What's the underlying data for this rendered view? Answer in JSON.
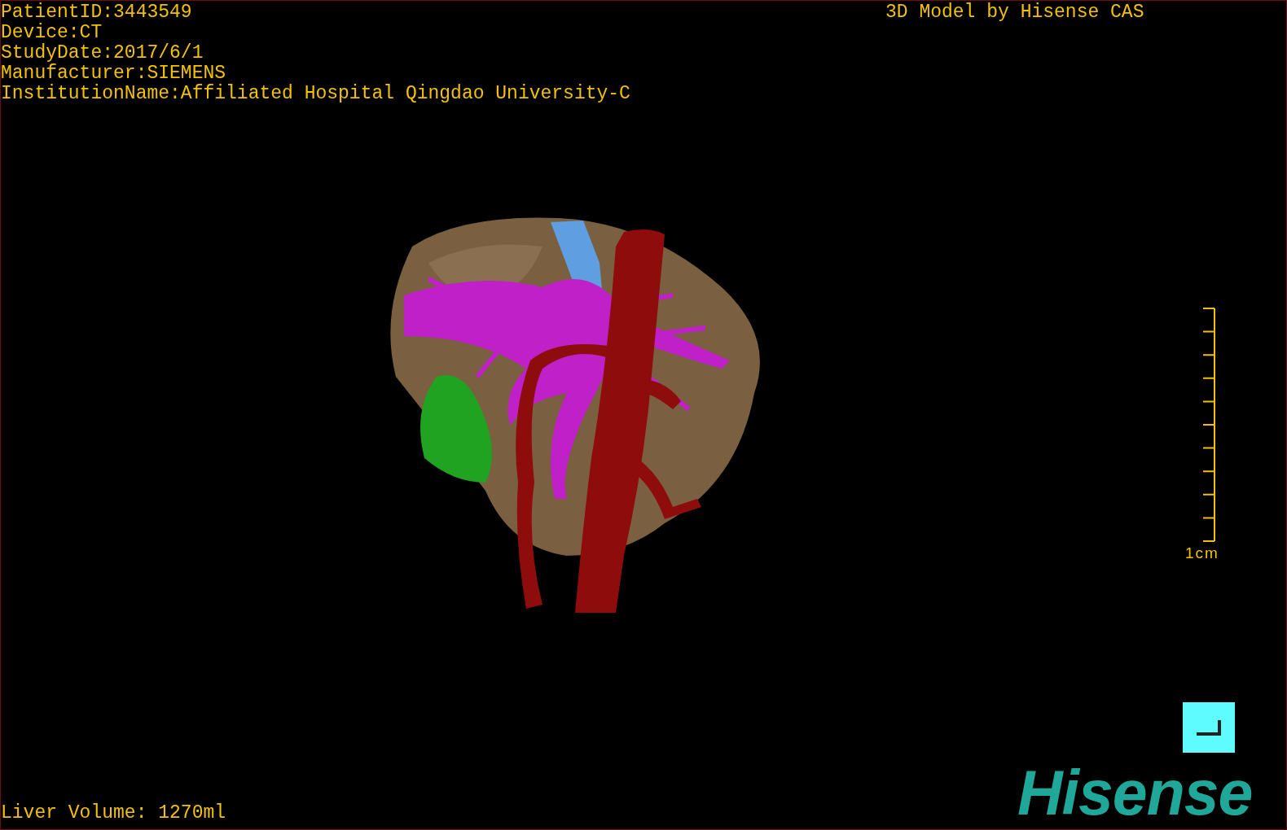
{
  "info_lines": [
    "PatientID:3443549",
    "Device:CT",
    "StudyDate:2017/6/1",
    "Manufacturer:SIEMENS",
    "InstitutionName:Affiliated Hospital Qingdao University-C"
  ],
  "model_title": "3D Model by Hisense CAS",
  "scale_bar": {
    "label": "1cm"
  },
  "liver_volume": "Liver Volume: 1270ml",
  "logo": "Hisense"
}
